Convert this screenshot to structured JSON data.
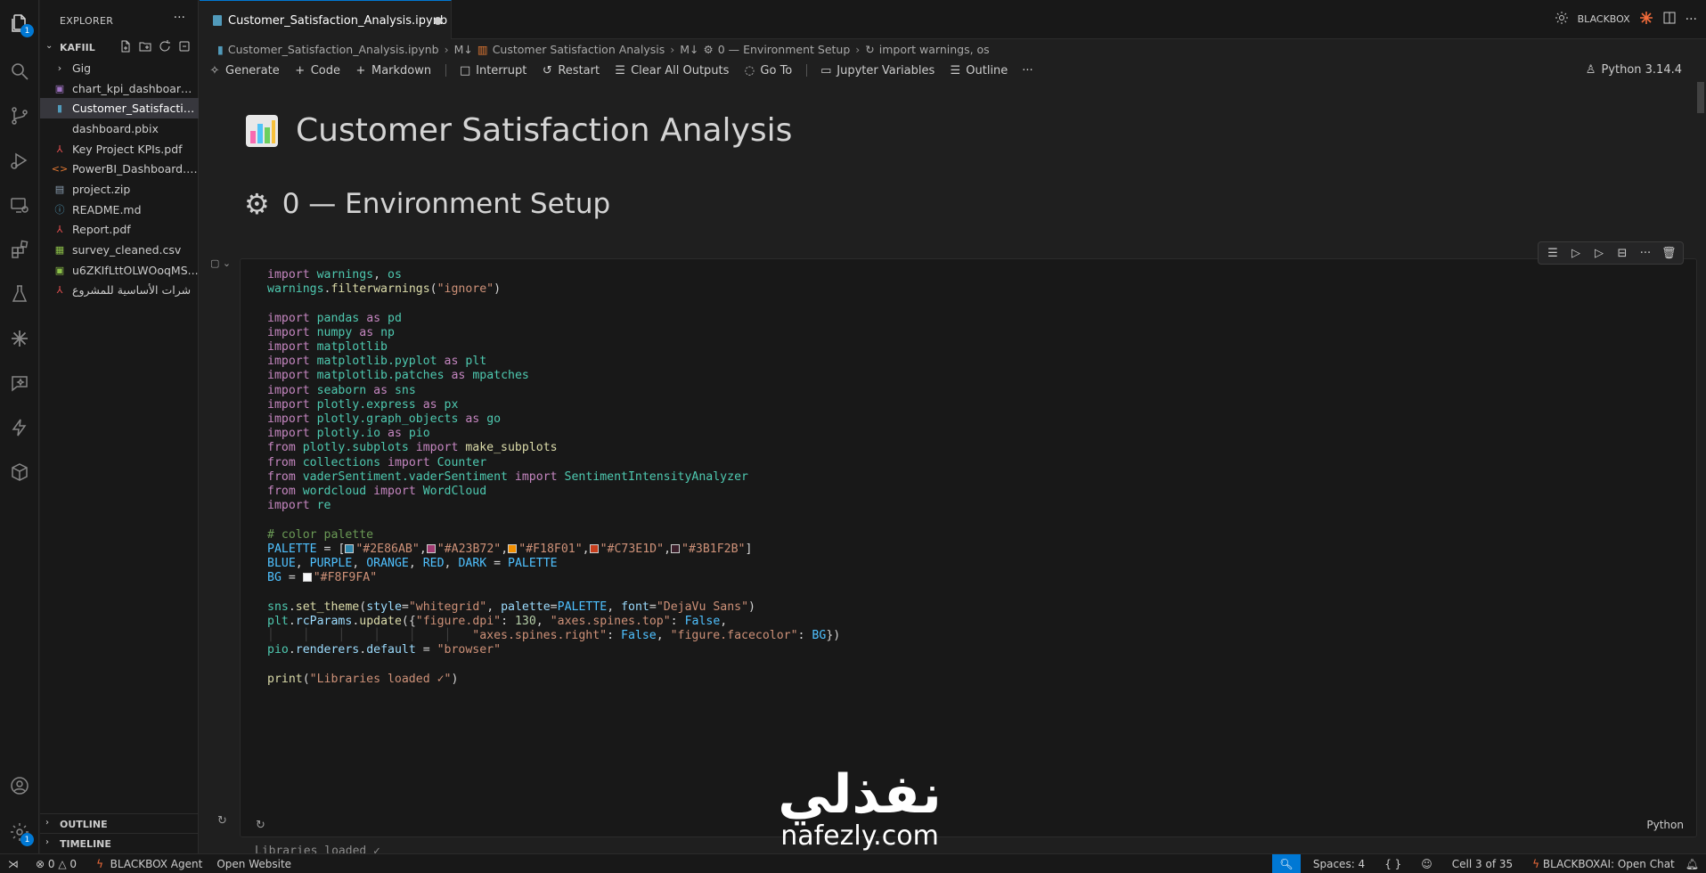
{
  "sidebar": {
    "title": "EXPLORER",
    "folder": "KAFIIL",
    "items": [
      {
        "name": "Gig",
        "type": "folder"
      },
      {
        "name": "chart_kpi_dashboard.p...",
        "type": "image"
      },
      {
        "name": "Customer_Satisfaction...",
        "type": "notebook"
      },
      {
        "name": "dashboard.pbix",
        "type": "file"
      },
      {
        "name": "Key Project KPIs.pdf",
        "type": "pdf"
      },
      {
        "name": "PowerBI_Dashboard.ht...",
        "type": "html"
      },
      {
        "name": "project.zip",
        "type": "zip"
      },
      {
        "name": "README.md",
        "type": "info"
      },
      {
        "name": "Report.pdf",
        "type": "pdf"
      },
      {
        "name": "survey_cleaned.csv",
        "type": "csv"
      },
      {
        "name": "u6ZKIfLttOLWOoqMS...",
        "type": "excel"
      },
      {
        "name": "شرات الأساسية للمشروع",
        "type": "pdf"
      }
    ],
    "outline_label": "OUTLINE",
    "timeline_label": "TIMELINE"
  },
  "tab": {
    "label": "Customer_Satisfaction_Analysis.ipynb"
  },
  "topright": {
    "blackbox_label": "BLACKBOX"
  },
  "breadcrumb": {
    "file": "Customer_Satisfaction_Analysis.ipynb",
    "md_marker": "M↓",
    "section1": "Customer Satisfaction Analysis",
    "section2": "0 — Environment Setup",
    "section3": "import warnings, os"
  },
  "toolbar": {
    "generate": "Generate",
    "code": "Code",
    "markdown": "Markdown",
    "interrupt": "Interrupt",
    "restart": "Restart",
    "clear": "Clear All Outputs",
    "goto": "Go To",
    "variables": "Jupyter Variables",
    "outline": "Outline",
    "kernel": "Python 3.14.4"
  },
  "notebook": {
    "h1": "Customer Satisfaction Analysis",
    "h2": "0 — Environment Setup",
    "cell_language": "Python",
    "output_text": "Libraries loaded ✓"
  },
  "palette": {
    "blue": "#2E86AB",
    "purple": "#A23B72",
    "orange": "#F18F01",
    "red": "#C73E1D",
    "dark": "#3B1F2B",
    "bg": "#F8F9FA"
  },
  "watermark": {
    "arabic": "نفذلي",
    "latin": "nafezly.com"
  },
  "status": {
    "errors": "0",
    "warnings": "0",
    "blackbox_agent": "BLACKBOX Agent",
    "open_website": "Open Website",
    "spaces": "Spaces: 4",
    "braces": "{ }",
    "cell": "Cell 3 of 35",
    "chat": "BLACKBOXAI: Open Chat"
  },
  "colors": {
    "accent": "#0078d4",
    "background": "#1f1f1f",
    "sidebar": "#181818"
  }
}
